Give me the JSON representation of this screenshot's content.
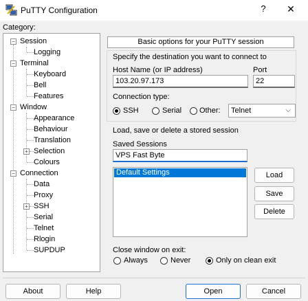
{
  "window": {
    "title": "PuTTY Configuration",
    "help_glyph": "?",
    "close_glyph": "✕"
  },
  "category": {
    "label": "Category:"
  },
  "tree": [
    {
      "label": "Session"
    },
    {
      "label": "Logging"
    },
    {
      "label": "Terminal"
    },
    {
      "label": "Keyboard"
    },
    {
      "label": "Bell"
    },
    {
      "label": "Features"
    },
    {
      "label": "Window"
    },
    {
      "label": "Appearance"
    },
    {
      "label": "Behaviour"
    },
    {
      "label": "Translation"
    },
    {
      "label": "Selection"
    },
    {
      "label": "Colours"
    },
    {
      "label": "Connection"
    },
    {
      "label": "Data"
    },
    {
      "label": "Proxy"
    },
    {
      "label": "SSH"
    },
    {
      "label": "Serial"
    },
    {
      "label": "Telnet"
    },
    {
      "label": "Rlogin"
    },
    {
      "label": "SUPDUP"
    }
  ],
  "panel": {
    "header": "Basic options for your PuTTY session",
    "dest_label": "Specify the destination you want to connect to",
    "host_label": "Host Name (or IP address)",
    "host_value": "103.20.97.173",
    "port_label": "Port",
    "port_value": "22",
    "conn_type_label": "Connection type:",
    "conn_types": [
      {
        "label": "SSH",
        "checked": true
      },
      {
        "label": "Serial",
        "checked": false
      },
      {
        "label": "Other:",
        "checked": false
      }
    ],
    "other_value": "Telnet",
    "load_save_label": "Load, save or delete a stored session",
    "saved_sessions_label": "Saved Sessions",
    "saved_sessions_value": "VPS Fast Byte",
    "sessions": [
      "Default Settings"
    ],
    "load_btn": "Load",
    "save_btn": "Save",
    "delete_btn": "Delete",
    "close_label": "Close window on exit:",
    "close_options": [
      {
        "label": "Always",
        "checked": false
      },
      {
        "label": "Never",
        "checked": false
      },
      {
        "label": "Only on clean exit",
        "checked": true
      }
    ]
  },
  "buttons": {
    "about": "About",
    "help": "Help",
    "open": "Open",
    "cancel": "Cancel"
  },
  "colors": {
    "selection": "#0078d7",
    "primary_border": "#1a6fcf"
  }
}
